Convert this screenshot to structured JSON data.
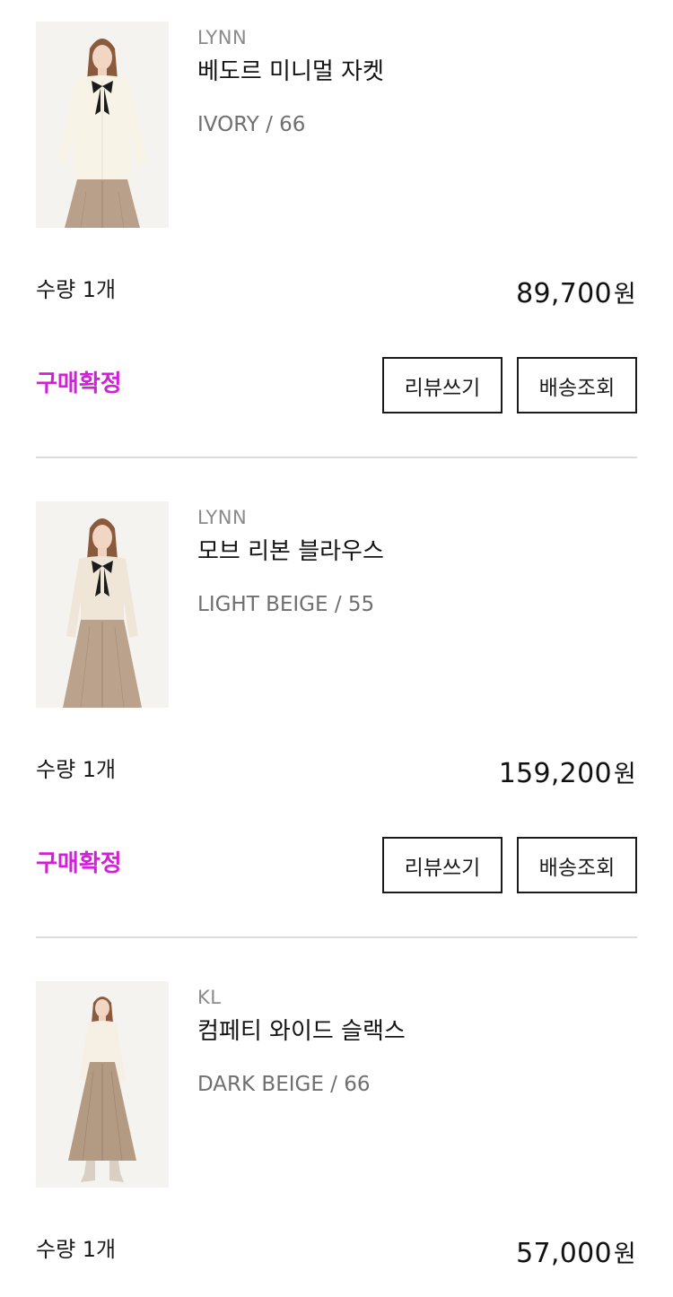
{
  "orders": [
    {
      "brand": "LYNN",
      "name": "베도르 미니멀 자켓",
      "option": "IVORY / 66",
      "quantity": "수량 1개",
      "price": "89,700",
      "currency": "원",
      "status": "구매확정",
      "review_label": "리뷰쓰기",
      "track_label": "배송조회",
      "image_icon": "product-photo-jacket"
    },
    {
      "brand": "LYNN",
      "name": "모브 리본 블라우스",
      "option": "LIGHT BEIGE / 55",
      "quantity": "수량 1개",
      "price": "159,200",
      "currency": "원",
      "status": "구매확정",
      "review_label": "리뷰쓰기",
      "track_label": "배송조회",
      "image_icon": "product-photo-blouse"
    },
    {
      "brand": "KL",
      "name": "컴페티 와이드 슬랙스",
      "option": "DARK BEIGE / 66",
      "quantity": "수량 1개",
      "price": "57,000",
      "currency": "원",
      "image_icon": "product-photo-slacks"
    }
  ],
  "colors": {
    "status": "#d21fd9",
    "brand": "#8a8a8a",
    "option": "#6f6f6f",
    "divider": "#dcdcdc"
  }
}
